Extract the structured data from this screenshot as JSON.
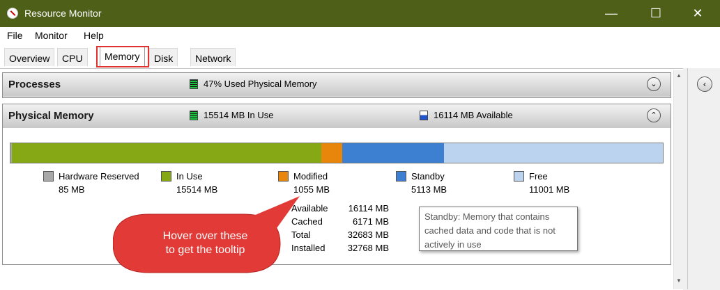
{
  "window": {
    "title": "Resource Monitor",
    "minimize": "—",
    "maximize": "☐",
    "close": "✕"
  },
  "menu": [
    "File",
    "Monitor",
    "Help"
  ],
  "tabs": [
    "Overview",
    "CPU",
    "Memory",
    "Disk",
    "Network"
  ],
  "active_tab": "Memory",
  "processes": {
    "title": "Processes",
    "used_text": "47% Used Physical Memory",
    "toggle": "⌄"
  },
  "physical": {
    "title": "Physical Memory",
    "in_use_text": "15514 MB In Use",
    "available_text": "16114 MB Available",
    "toggle": "⌃",
    "segments": [
      {
        "name": "Hardware Reserved",
        "value_mb": 85,
        "color": "#a8a8a8"
      },
      {
        "name": "In Use",
        "value_mb": 15514,
        "color": "#85a814"
      },
      {
        "name": "Modified",
        "value_mb": 1055,
        "color": "#e8860c"
      },
      {
        "name": "Standby",
        "value_mb": 5113,
        "color": "#3d7fd0"
      },
      {
        "name": "Free",
        "value_mb": 11001,
        "color": "#bcd3f0"
      }
    ],
    "legend": [
      {
        "label": "Hardware Reserved",
        "value": "85 MB"
      },
      {
        "label": "In Use",
        "value": "15514 MB"
      },
      {
        "label": "Modified",
        "value": "1055 MB"
      },
      {
        "label": "Standby",
        "value": "5113 MB"
      },
      {
        "label": "Free",
        "value": "11001 MB"
      }
    ],
    "stats": [
      {
        "label": "Available",
        "value": "16114 MB"
      },
      {
        "label": "Cached",
        "value": "6171 MB"
      },
      {
        "label": "Total",
        "value": "32683 MB"
      },
      {
        "label": "Installed",
        "value": "32768 MB"
      }
    ]
  },
  "tooltip": {
    "lines": [
      "Standby: Memory that contains",
      "cached data and code that is not",
      "actively in use"
    ]
  },
  "callout": {
    "line1": "Hover over these",
    "line2": "to get the tooltip",
    "color": "#e23a36"
  },
  "right_toggle": "‹",
  "scroll": {
    "up": "▲",
    "down": "▼"
  }
}
